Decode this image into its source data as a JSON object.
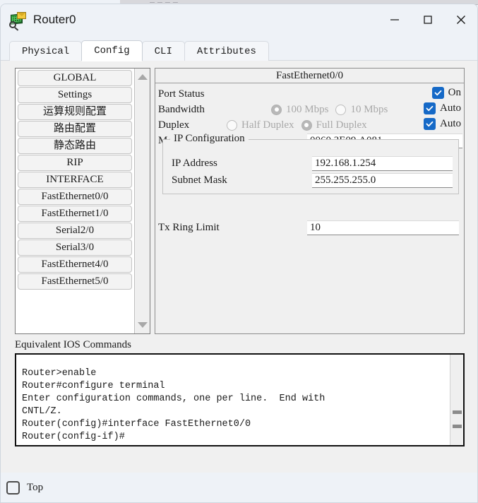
{
  "window": {
    "title": "Router0",
    "icon": "router-magnifier-icon",
    "minimize_label": "—",
    "maximize_label": "□",
    "close_label": "✕"
  },
  "background_window": {
    "ghost_title": "— — — —"
  },
  "tabs": [
    {
      "label": "Physical",
      "active": false
    },
    {
      "label": "Config",
      "active": true
    },
    {
      "label": "CLI",
      "active": false
    },
    {
      "label": "Attributes",
      "active": false
    }
  ],
  "sidebar": {
    "items": [
      {
        "label": "GLOBAL"
      },
      {
        "label": "Settings"
      },
      {
        "label": "运算规则配置"
      },
      {
        "label": "路由配置"
      },
      {
        "label": "静态路由"
      },
      {
        "label": "RIP"
      },
      {
        "label": "INTERFACE"
      },
      {
        "label": "FastEthernet0/0"
      },
      {
        "label": "FastEthernet1/0"
      },
      {
        "label": "Serial2/0"
      },
      {
        "label": "Serial3/0"
      },
      {
        "label": "FastEthernet4/0"
      },
      {
        "label": "FastEthernet5/0"
      }
    ],
    "scroll_up_icon": "triangle-up-icon",
    "scroll_down_icon": "triangle-down-icon"
  },
  "config": {
    "header": "FastEthernet0/0",
    "port_status": {
      "label": "Port Status",
      "on_label": "On",
      "checked": true
    },
    "bandwidth": {
      "label": "Bandwidth",
      "options": [
        {
          "label": "100 Mbps",
          "selected": true
        },
        {
          "label": "10 Mbps",
          "selected": false
        }
      ],
      "auto_label": "Auto",
      "auto_checked": true
    },
    "duplex": {
      "label": "Duplex",
      "options": [
        {
          "label": "Half Duplex",
          "selected": false
        },
        {
          "label": "Full Duplex",
          "selected": true
        }
      ],
      "auto_label": "Auto",
      "auto_checked": true
    },
    "mac_address": {
      "label": "MAC Address",
      "value": "0060.3E09.A081"
    },
    "ip_configuration": {
      "legend": "IP Configuration",
      "ip_address": {
        "label": "IP Address",
        "value": "192.168.1.254"
      },
      "subnet_mask": {
        "label": "Subnet Mask",
        "value": "255.255.255.0"
      }
    },
    "tx_ring_limit": {
      "label": "Tx Ring Limit",
      "value": "10"
    }
  },
  "ios": {
    "title": "Equivalent IOS Commands",
    "text": "Router>enable\nRouter#configure terminal\nEnter configuration commands, one per line.  End with\nCNTL/Z.\nRouter(config)#interface FastEthernet0/0\nRouter(config-if)#"
  },
  "bottom": {
    "top_label": "Top",
    "top_checked": false
  },
  "colors": {
    "accent_checkbox": "#1569C7",
    "window_bg": "#EEF2F7",
    "panel_bg": "#F0F0F0",
    "disabled_text": "#A8A8A8"
  }
}
